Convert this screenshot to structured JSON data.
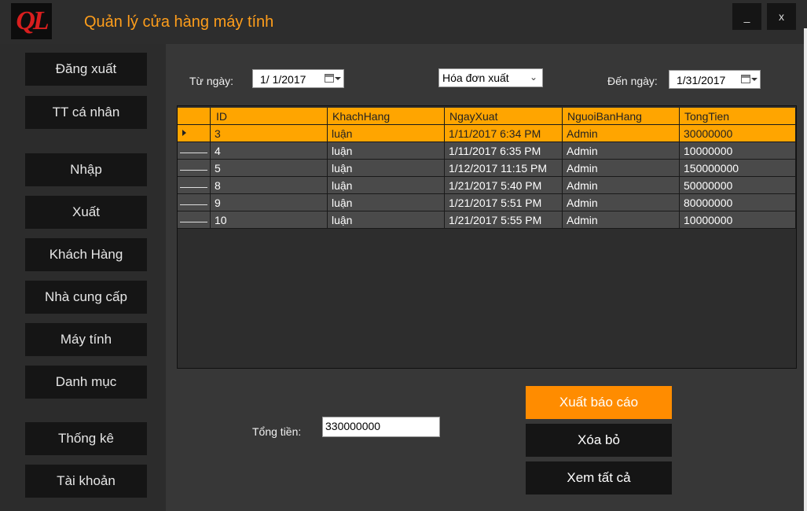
{
  "window": {
    "logo_text": "QL",
    "title": "Quản lý cửa hàng máy tính",
    "minimize_label": "_",
    "close_label": "x"
  },
  "sidebar": {
    "items": [
      {
        "label": "Đăng xuất"
      },
      {
        "label": "TT cá nhân"
      },
      {
        "label": "Nhập"
      },
      {
        "label": "Xuất"
      },
      {
        "label": "Khách Hàng"
      },
      {
        "label": "Nhà cung cấp"
      },
      {
        "label": "Máy tính"
      },
      {
        "label": "Danh mục"
      },
      {
        "label": "Thống kê"
      },
      {
        "label": "Tài khoản"
      }
    ]
  },
  "filters": {
    "from_label": "Từ ngày:",
    "from_value": "1/  1/2017",
    "type_value": "Hóa đơn xuất",
    "to_label": "Đến ngày:",
    "to_value": "1/31/2017"
  },
  "table": {
    "columns": [
      "ID",
      "KhachHang",
      "NgayXuat",
      "NguoiBanHang",
      "TongTien"
    ],
    "rows": [
      [
        "3",
        "luận",
        "1/11/2017 6:34 PM",
        "Admin",
        "30000000"
      ],
      [
        "4",
        "luận",
        "1/11/2017 6:35 PM",
        "Admin",
        "10000000"
      ],
      [
        "5",
        "luận",
        "1/12/2017 11:15 PM",
        "Admin",
        "150000000"
      ],
      [
        "8",
        "luận",
        "1/21/2017 5:40 PM",
        "Admin",
        "50000000"
      ],
      [
        "9",
        "luận",
        "1/21/2017 5:51 PM",
        "Admin",
        "80000000"
      ],
      [
        "10",
        "luận",
        "1/21/2017 5:55 PM",
        "Admin",
        "10000000"
      ]
    ],
    "selected_row": 0
  },
  "total": {
    "label": "Tổng tiền:",
    "value": "330000000"
  },
  "actions": {
    "export_label": "Xuất báo cáo",
    "delete_label": "Xóa bỏ",
    "view_all_label": "Xem tất cả"
  },
  "colors": {
    "accent": "#ffa500",
    "export_button": "#ff8c00",
    "title_text": "#ff9e1b",
    "logo_red": "#d81e1e"
  }
}
